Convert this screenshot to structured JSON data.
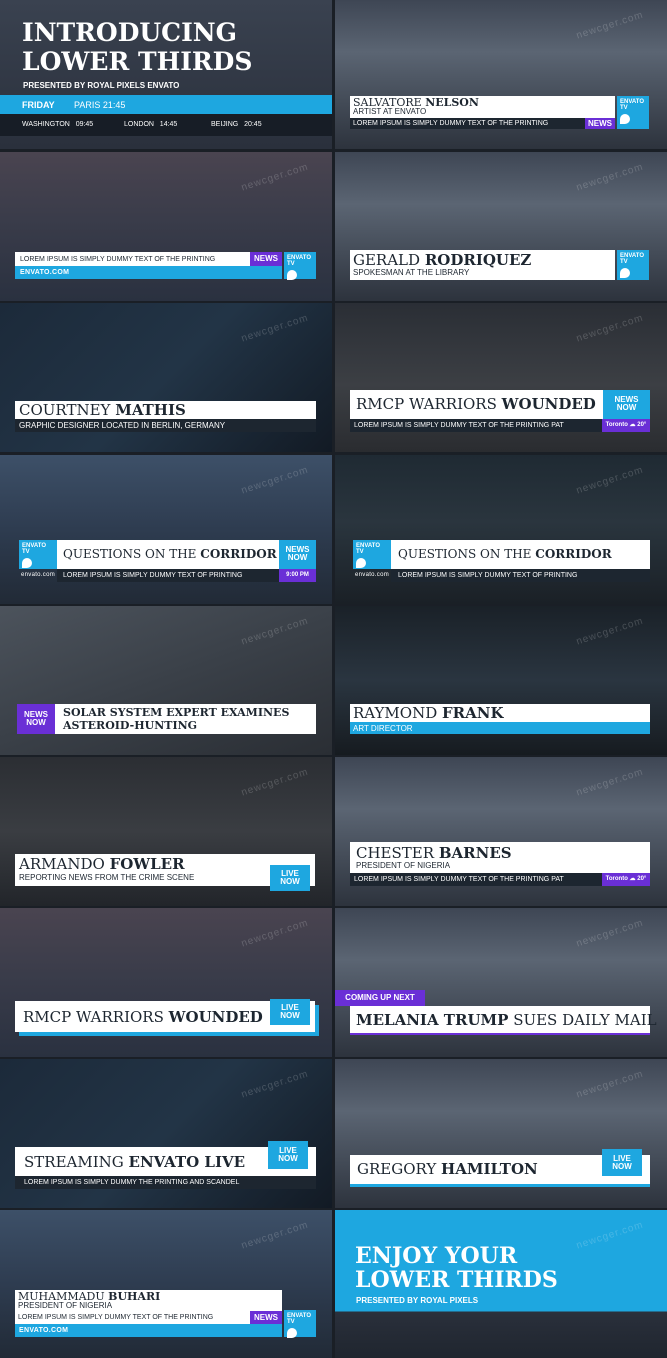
{
  "watermark": "newcger.com",
  "intro": {
    "title_line1": "INTRODUCING",
    "title_line2": "LOWER THIRDS",
    "presented": "PRESENTED BY ROYAL PIXELS ENVATO",
    "day": "FRIDAY",
    "city_main": "PARIS 21:45",
    "clocks": [
      {
        "city": "WASHINGTON",
        "time": "09:45"
      },
      {
        "city": "LONDON",
        "time": "14:45"
      },
      {
        "city": "BEIJING",
        "time": "20:45"
      }
    ]
  },
  "t2": {
    "first": "SALVATORE",
    "last": "NELSON",
    "sub": "ARTIST AT ENVATO",
    "ticker": "LOREM IPSUM IS SIMPLY DUMMY TEXT OF THE PRINTING",
    "badge": "NEWS",
    "logo1": "ENVATO",
    "logo2": "TV"
  },
  "t3": {
    "ticker": "LOREM IPSUM IS SIMPLY DUMMY TEXT OF THE PRINTING",
    "badge": "NEWS",
    "logo1": "ENVATO",
    "logo2": "TV",
    "brand": "ENVATO.COM"
  },
  "t4": {
    "first": "GERALD",
    "last": "RODRIQUEZ",
    "sub": "SPOKESMAN AT THE LIBRARY",
    "logo1": "ENVATO",
    "logo2": "TV"
  },
  "t5": {
    "first": "COURTNEY",
    "last": "MATHIS",
    "sub": "GRAPHIC DESIGNER LOCATED IN BERLIN, GERMANY"
  },
  "t6": {
    "first": "RMCP WARRIORS",
    "last": "WOUNDED",
    "ticker": "LOREM IPSUM IS SIMPLY DUMMY TEXT OF THE PRINTING PAT",
    "badge1": "NEWS",
    "badge2": "NOW",
    "city": "Toronto",
    "temp": "20°"
  },
  "t7": {
    "first": "QUESTIONS ON THE",
    "last": "CORRIDOR",
    "ticker": "LOREM IPSUM IS SIMPLY DUMMY TEXT OF PRINTING",
    "badge1": "NEWS",
    "badge2": "NOW",
    "time": "9:00 PM",
    "logo1": "ENVATO",
    "logo2": "TV",
    "brand": "envato.com"
  },
  "t8": {
    "first": "QUESTIONS ON THE",
    "last": "CORRIDOR",
    "ticker": "LOREM IPSUM IS SIMPLY DUMMY TEXT OF PRINTING",
    "logo1": "ENVATO",
    "logo2": "TV",
    "brand": "envato.com"
  },
  "t9": {
    "line1": "SOLAR SYSTEM EXPERT EXAMINES",
    "line2": "ASTEROID-HUNTING",
    "badge1": "NEWS",
    "badge2": "NOW"
  },
  "t10": {
    "first": "RAYMOND",
    "last": "FRANK",
    "sub": "ART DIRECTOR"
  },
  "t11": {
    "first": "ARMANDO",
    "last": "FOWLER",
    "sub": "REPORTING NEWS FROM THE CRIME SCENE",
    "badge1": "LIVE",
    "badge2": "NOW"
  },
  "t12": {
    "first": "CHESTER",
    "last": "BARNES",
    "sub": "PRESIDENT OF NIGERIA",
    "ticker": "LOREM IPSUM IS SIMPLY DUMMY TEXT OF THE PRINTING PAT",
    "city": "Toronto",
    "temp": "20°"
  },
  "t13": {
    "first": "RMCP WARRIORS",
    "last": "WOUNDED",
    "badge1": "LIVE",
    "badge2": "NOW"
  },
  "t14": {
    "tag": "COMING UP NEXT",
    "first": "MELANIA TRUMP",
    "last": "SUES DAILY MAIL"
  },
  "t15": {
    "first": "STREAMING",
    "last": "ENVATO LIVE",
    "ticker": "LOREM IPSUM IS SIMPLY DUMMY THE PRINTING AND SCANDEL",
    "badge1": "LIVE",
    "badge2": "NOW"
  },
  "t16": {
    "first": "GREGORY",
    "last": "HAMILTON",
    "badge1": "LIVE",
    "badge2": "NOW"
  },
  "t17": {
    "first": "MUHAMMADU",
    "last": "BUHARI",
    "sub": "PRESIDENT OF NIGERIA",
    "ticker": "LOREM IPSUM IS SIMPLY DUMMY TEXT OF THE PRINTING",
    "badge": "NEWS",
    "logo1": "ENVATO",
    "logo2": "TV",
    "brand": "ENVATO.COM"
  },
  "outro": {
    "line1": "ENJOY YOUR",
    "line2": "LOWER THIRDS",
    "presented": "PRESENTED BY ROYAL PIXELS"
  },
  "colors": {
    "accent": "#1ea7e0",
    "purple": "#6a2fd6",
    "dark": "#1d2630",
    "white": "#ffffff"
  }
}
